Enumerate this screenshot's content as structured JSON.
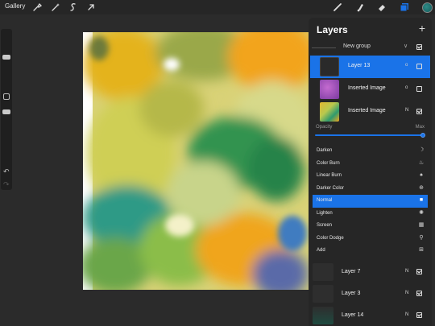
{
  "topbar": {
    "gallery_label": "Gallery",
    "tools_left": [
      "wrench-icon",
      "magic-wand-icon",
      "selection-icon",
      "transform-arrow-icon"
    ],
    "tools_right": [
      "brush-icon",
      "smudge-icon",
      "eraser-icon",
      "layers-icon"
    ],
    "active_tool": "layers-icon",
    "current_color": "#1f6f6e"
  },
  "sidebar": {
    "controls": [
      "brush-size-slider",
      "modify-button",
      "opacity-slider",
      "undo-button",
      "redo-button"
    ],
    "undo_glyph": "↶",
    "redo_glyph": "↷"
  },
  "layers_panel": {
    "title": "Layers",
    "add_symbol": "+",
    "group": {
      "label": "New group",
      "expanded": true,
      "visible": true
    },
    "layers": [
      {
        "name": "Layer 13",
        "mode": "o",
        "visible": false,
        "selected": true,
        "thumb": "dark"
      },
      {
        "name": "Inserted Image",
        "mode": "o",
        "visible": false,
        "selected": false,
        "thumb": "purple"
      },
      {
        "name": "Inserted Image",
        "mode": "N",
        "visible": true,
        "selected": false,
        "thumb": "watercolor"
      }
    ],
    "opacity": {
      "label": "Opacity",
      "max_label": "Max",
      "value": 1.0
    },
    "blend_modes": [
      {
        "label": "Darken",
        "icon": "moon-icon",
        "glyph": "☽",
        "selected": false
      },
      {
        "label": "Color Burn",
        "icon": "flame-icon",
        "glyph": "♨",
        "selected": false
      },
      {
        "label": "Linear Burn",
        "icon": "fire-icon",
        "glyph": "♠",
        "selected": false
      },
      {
        "label": "Darker Color",
        "icon": "plus-circle-icon",
        "glyph": "⊕",
        "selected": false
      },
      {
        "label": "Normal",
        "icon": "square-icon",
        "glyph": "■",
        "selected": true
      },
      {
        "label": "Lighten",
        "icon": "sun-icon",
        "glyph": "✺",
        "selected": false
      },
      {
        "label": "Screen",
        "icon": "screen-icon",
        "glyph": "▦",
        "selected": false
      },
      {
        "label": "Color Dodge",
        "icon": "magnifier-icon",
        "glyph": "⚲",
        "selected": false
      },
      {
        "label": "Add",
        "icon": "add-icon",
        "glyph": "⊞",
        "selected": false
      }
    ],
    "bottom_layers": [
      {
        "name": "Layer 7",
        "mode": "N",
        "visible": true
      },
      {
        "name": "Layer 3",
        "mode": "N",
        "visible": true
      },
      {
        "name": "Layer 14",
        "mode": "N",
        "visible": true
      }
    ]
  },
  "colors": {
    "accent": "#1a73e8",
    "panel_bg": "#262626",
    "workspace_bg": "#2b2b2b"
  }
}
